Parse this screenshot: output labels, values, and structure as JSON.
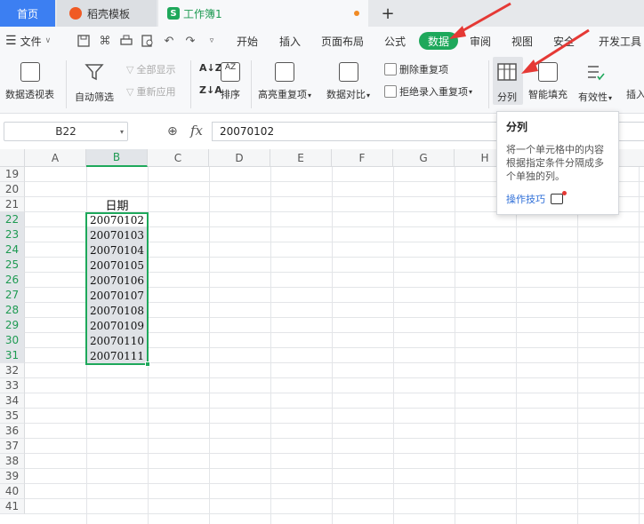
{
  "tabs": {
    "home": "首页",
    "template": "稻壳模板",
    "workbook": "工作簿1",
    "workbook_icon": "S",
    "add": "+"
  },
  "menu": {
    "file": "文件",
    "items": [
      "开始",
      "插入",
      "页面布局",
      "公式",
      "数据",
      "审阅",
      "视图",
      "安全",
      "开发工具"
    ],
    "active": "数据"
  },
  "ribbon": {
    "pivot": "数据透视表",
    "autofilter": "自动筛选",
    "show_all": "全部显示",
    "reapply": "重新应用",
    "sort": "排序",
    "highlight_dup": "高亮重复项",
    "compare": "数据对比",
    "remove_dup": "删除重复项",
    "reject_dup": "拒绝录入重复项",
    "split": "分列",
    "smart_fill": "智能填充",
    "validity": "有效性",
    "insert": "插入"
  },
  "formula_bar": {
    "name_box": "B22",
    "fx": "fx",
    "value": "20070102"
  },
  "grid": {
    "columns": [
      "A",
      "B",
      "C",
      "D",
      "E",
      "F",
      "G",
      "H"
    ],
    "selected_column": "B",
    "rows": [
      "19",
      "20",
      "21",
      "22",
      "23",
      "24",
      "25",
      "26",
      "27",
      "28",
      "29",
      "30",
      "31",
      "32",
      "33",
      "34",
      "35",
      "36",
      "37",
      "38",
      "39",
      "40",
      "41"
    ],
    "b21": "日期",
    "dates": [
      "20070102",
      "20070103",
      "20070104",
      "20070105",
      "20070106",
      "20070107",
      "20070108",
      "20070109",
      "20070110",
      "20070111"
    ]
  },
  "tooltip": {
    "title": "分列",
    "description": "将一个单元格中的内容根据指定条件分隔成多个单独的列。",
    "link": "操作技巧"
  },
  "colors": {
    "accent_green": "#1ea85b",
    "home_tab_blue": "#3c7ff2",
    "arrow_red": "#e53935"
  }
}
